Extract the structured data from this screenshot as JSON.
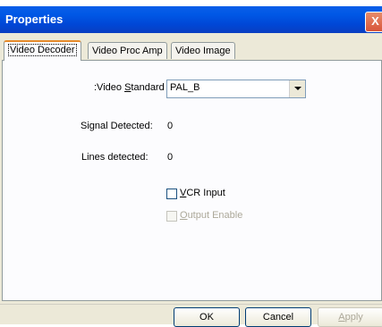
{
  "window": {
    "title": "Properties",
    "close_glyph": "X"
  },
  "tabs": [
    {
      "label": "Video Decoder",
      "active": true
    },
    {
      "label": "Video Proc Amp",
      "active": false
    },
    {
      "label": "Video Image",
      "active": false
    }
  ],
  "video_standard": {
    "label_prefix": ":Video ",
    "label_underlined": "S",
    "label_suffix": "tandard",
    "value": "PAL_B"
  },
  "signal_detected": {
    "label": "Signal Detected:",
    "value": "0"
  },
  "lines_detected": {
    "label": "Lines detected:",
    "value": "0"
  },
  "vcr_input": {
    "underlined": "V",
    "rest": "CR Input",
    "checked": false,
    "enabled": true
  },
  "output_enable": {
    "underlined": "O",
    "rest": "utput Enable",
    "checked": false,
    "enabled": false
  },
  "buttons": {
    "ok": "OK",
    "cancel": "Cancel",
    "apply_underlined": "A",
    "apply_rest": "pply"
  },
  "colors": {
    "titlebar": "#0058e6",
    "window_bg": "#ece9d8",
    "active_tab_accent": "#e68b2c"
  }
}
